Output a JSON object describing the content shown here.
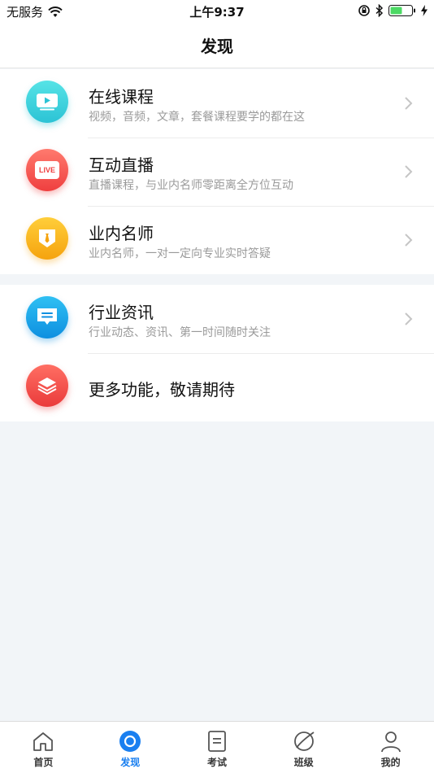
{
  "status_bar": {
    "carrier": "无服务",
    "time": "上午9:37"
  },
  "nav": {
    "title": "发现"
  },
  "sections": [
    {
      "items": [
        {
          "title": "在线课程",
          "subtitle": "视频，音频，文章，套餐课程要学的都在这",
          "icon": "video-icon",
          "color": "#3fd3dc"
        },
        {
          "title": "互动直播",
          "subtitle": "直播课程，与业内名师零距离全方位互动",
          "icon": "live-icon",
          "color": "#f5574f",
          "badge": "LIVE"
        },
        {
          "title": "业内名师",
          "subtitle": "业内名师，一对一定向专业实时答疑",
          "icon": "teacher-icon",
          "color": "#f7b317"
        }
      ]
    },
    {
      "items": [
        {
          "title": "行业资讯",
          "subtitle": "行业动态、资讯、第一时间随时关注",
          "icon": "message-icon",
          "color": "#1aa6ec"
        },
        {
          "title": "更多功能，敬请期待",
          "icon": "layers-icon",
          "color": "#f2504a"
        }
      ]
    }
  ],
  "tabs": [
    {
      "label": "首页",
      "icon": "home-icon",
      "active": false
    },
    {
      "label": "发现",
      "icon": "discover-icon",
      "active": true
    },
    {
      "label": "考试",
      "icon": "exam-icon",
      "active": false
    },
    {
      "label": "班级",
      "icon": "class-icon",
      "active": false
    },
    {
      "label": "我的",
      "icon": "profile-icon",
      "active": false
    }
  ],
  "colors": {
    "accent": "#1a7ff0",
    "background": "#f2f5f8"
  }
}
